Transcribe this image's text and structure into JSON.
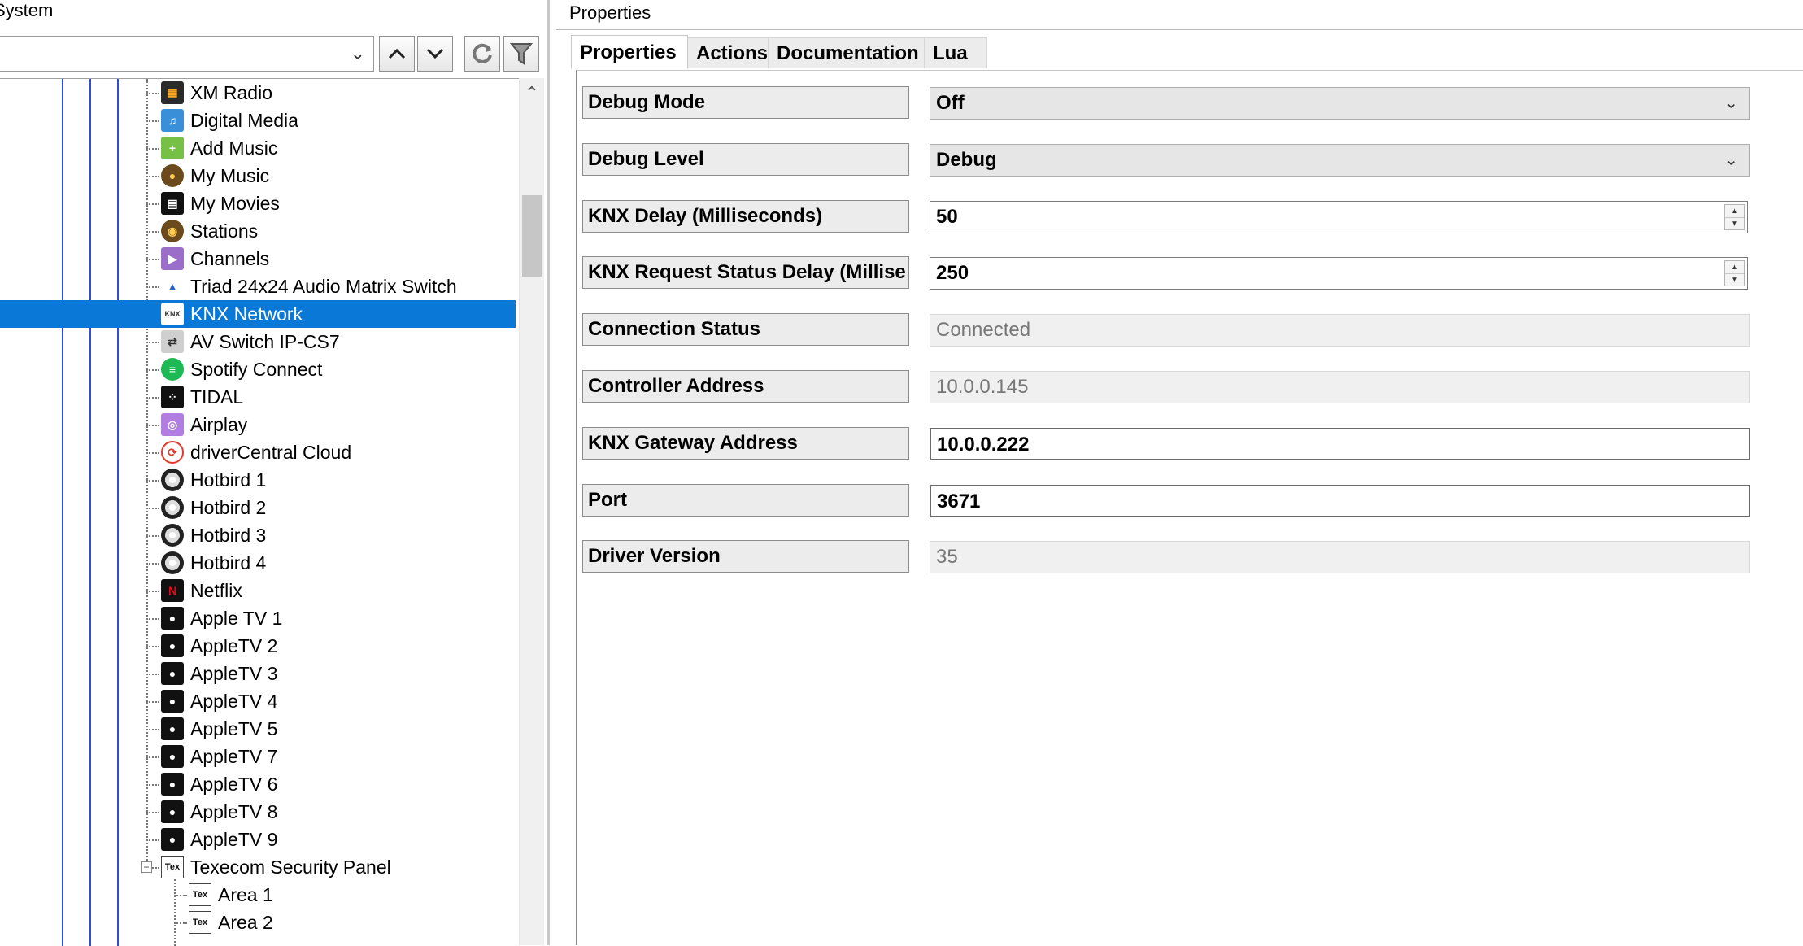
{
  "left_panel": {
    "title": "System",
    "toolbar": {
      "system_select_value": "",
      "up_icon": "chevron-up-icon",
      "down_icon": "chevron-down-icon",
      "refresh_icon": "refresh-icon",
      "filter_icon": "filter-icon"
    },
    "tree": {
      "items": [
        {
          "label": "XM Radio",
          "icon": "xm-radio-icon",
          "glyph": "▦"
        },
        {
          "label": "Digital Media",
          "icon": "digital-media-icon",
          "glyph": "♫"
        },
        {
          "label": "Add Music",
          "icon": "add-music-icon",
          "glyph": "+"
        },
        {
          "label": "My Music",
          "icon": "my-music-icon",
          "glyph": "●"
        },
        {
          "label": "My Movies",
          "icon": "my-movies-icon",
          "glyph": "▤"
        },
        {
          "label": "Stations",
          "icon": "stations-icon",
          "glyph": "◉"
        },
        {
          "label": "Channels",
          "icon": "channels-icon",
          "glyph": "▶"
        },
        {
          "label": "Triad 24x24 Audio Matrix Switch",
          "icon": "triad-switch-icon",
          "glyph": "▲"
        },
        {
          "label": "KNX Network",
          "icon": "knx-network-icon",
          "glyph": "KNX",
          "selected": true
        },
        {
          "label": "AV Switch IP-CS7",
          "icon": "av-switch-icon",
          "glyph": "⇄"
        },
        {
          "label": "Spotify Connect",
          "icon": "spotify-icon",
          "glyph": "≡"
        },
        {
          "label": "TIDAL",
          "icon": "tidal-icon",
          "glyph": "⁘"
        },
        {
          "label": "Airplay",
          "icon": "airplay-icon",
          "glyph": "◎"
        },
        {
          "label": "driverCentral Cloud",
          "icon": "drivercentral-cloud-icon",
          "glyph": "⟳"
        },
        {
          "label": "Hotbird 1",
          "icon": "satellite-dish-icon",
          "glyph": ""
        },
        {
          "label": "Hotbird 2",
          "icon": "satellite-dish-icon",
          "glyph": ""
        },
        {
          "label": "Hotbird 3",
          "icon": "satellite-dish-icon",
          "glyph": ""
        },
        {
          "label": "Hotbird 4",
          "icon": "satellite-dish-icon",
          "glyph": ""
        },
        {
          "label": "Netflix",
          "icon": "netflix-icon",
          "glyph": "N"
        },
        {
          "label": "Apple TV 1",
          "icon": "apple-tv-icon",
          "glyph": "●"
        },
        {
          "label": "AppleTV 2",
          "icon": "apple-tv-icon",
          "glyph": "●"
        },
        {
          "label": "AppleTV 3",
          "icon": "apple-tv-icon",
          "glyph": "●"
        },
        {
          "label": "AppleTV 4",
          "icon": "apple-tv-icon",
          "glyph": "●"
        },
        {
          "label": "AppleTV 5",
          "icon": "apple-tv-icon",
          "glyph": "●"
        },
        {
          "label": "AppleTV 7",
          "icon": "apple-tv-icon",
          "glyph": "●"
        },
        {
          "label": "AppleTV 6",
          "icon": "apple-tv-icon",
          "glyph": "●"
        },
        {
          "label": "AppleTV 8",
          "icon": "apple-tv-icon",
          "glyph": "●"
        },
        {
          "label": "AppleTV 9",
          "icon": "apple-tv-icon",
          "glyph": "●"
        },
        {
          "label": "Texecom Security Panel",
          "icon": "texecom-icon",
          "glyph": "Tex",
          "expander": "−"
        },
        {
          "label": "Area 1",
          "icon": "texecom-icon",
          "glyph": "Tex",
          "child": true
        },
        {
          "label": "Area 2",
          "icon": "texecom-icon",
          "glyph": "Tex",
          "child": true
        }
      ]
    }
  },
  "right_panel": {
    "title": "Properties",
    "tabs": [
      {
        "label": "Properties",
        "active": true
      },
      {
        "label": "Actions"
      },
      {
        "label": "Documentation"
      },
      {
        "label": "Lua"
      }
    ],
    "properties": [
      {
        "label": "Debug Mode",
        "value": "Off",
        "kind": "dropdown"
      },
      {
        "label": "Debug Level",
        "value": "Debug",
        "kind": "dropdown"
      },
      {
        "label": "KNX Delay (Milliseconds)",
        "value": "50",
        "kind": "spinner"
      },
      {
        "label": "KNX Request Status Delay (Millise",
        "value": "250",
        "kind": "spinner"
      },
      {
        "label": "Connection Status",
        "value": "Connected",
        "kind": "readonly"
      },
      {
        "label": "Controller Address",
        "value": "10.0.0.145",
        "kind": "readonly"
      },
      {
        "label": "KNX Gateway Address",
        "value": "10.0.0.222",
        "kind": "text"
      },
      {
        "label": "Port",
        "value": "3671",
        "kind": "text"
      },
      {
        "label": "Driver Version",
        "value": "35",
        "kind": "readonly"
      }
    ]
  },
  "colors": {
    "selection": "#0a78d7",
    "tree_guides": "#2b4fd8",
    "label_bg": "#ececec",
    "readonly_bg": "#f0f0f0"
  }
}
